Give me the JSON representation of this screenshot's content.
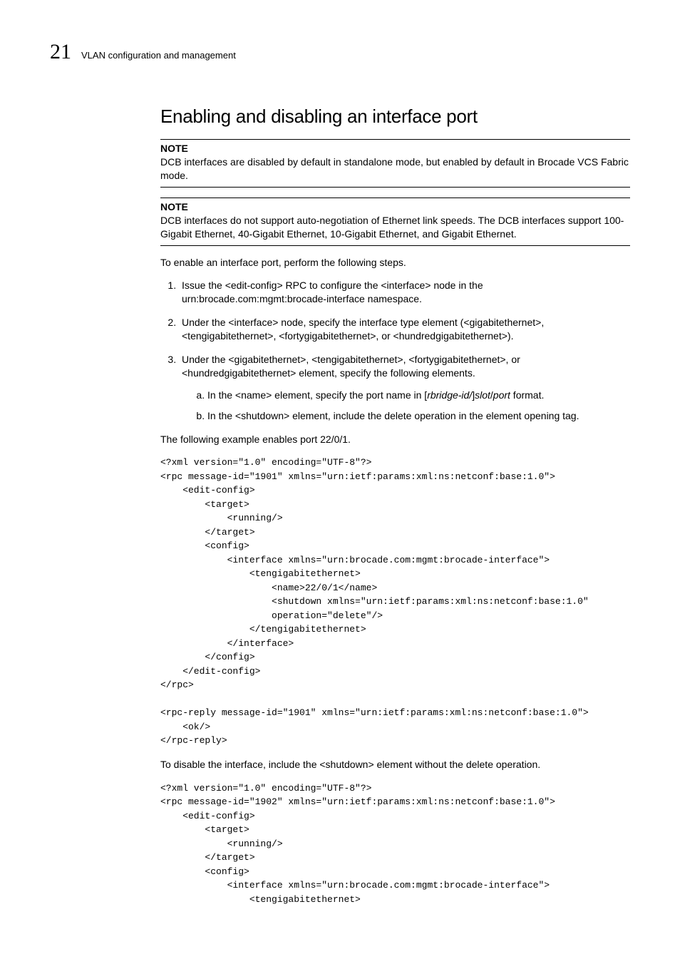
{
  "header": {
    "chapnum": "21",
    "chapter": "VLAN configuration and management"
  },
  "section_title": "Enabling and disabling an interface port",
  "note1": {
    "label": "NOTE",
    "body": "DCB interfaces are disabled by default in standalone mode, but enabled by default in Brocade VCS Fabric mode."
  },
  "note2": {
    "label": "NOTE",
    "body": "DCB interfaces do not support auto-negotiation of Ethernet link speeds. The DCB interfaces support 100-Gigabit Ethernet, 40-Gigabit Ethernet, 10-Gigabit Ethernet, and Gigabit Ethernet."
  },
  "intro": "To enable an interface port, perform the following steps.",
  "step1": "Issue the <edit-config> RPC to configure the <interface> node in the urn:brocade.com:mgmt:brocade-interface namespace.",
  "step2": "Under the <interface> node, specify the interface type element (<gigabitethernet>, <tengigabitethernet>, <fortygigabitethernet>, or <hundredgigabitethernet>).",
  "step3": "Under the <gigabitethernet>, <tengigabitethernet>, <fortygigabitethernet>, or <hundredgigabitethernet> element, specify the following elements.",
  "step3a_pre": "In the <name> element, specify the port name in [",
  "step3a_it1": "rbridge-id/",
  "step3a_mid1": "]",
  "step3a_it2": "slot",
  "step3a_mid2": "/",
  "step3a_it3": "port",
  "step3a_post": " format.",
  "step3b": "In the <shutdown> element, include the delete operation in the element opening tag.",
  "example_intro": "The following example enables port 22/0/1.",
  "code1": "<?xml version=\"1.0\" encoding=\"UTF-8\"?>\n<rpc message-id=\"1901\" xmlns=\"urn:ietf:params:xml:ns:netconf:base:1.0\">\n    <edit-config>\n        <target>\n            <running/>\n        </target>\n        <config>\n            <interface xmlns=\"urn:brocade.com:mgmt:brocade-interface\">\n                <tengigabitethernet>\n                    <name>22/0/1</name>\n                    <shutdown xmlns=\"urn:ietf:params:xml:ns:netconf:base:1.0\"\n                    operation=\"delete\"/>\n                </tengigabitethernet>\n            </interface>\n        </config>\n    </edit-config>\n</rpc>\n\n<rpc-reply message-id=\"1901\" xmlns=\"urn:ietf:params:xml:ns:netconf:base:1.0\">\n    <ok/>\n</rpc-reply>",
  "disable_intro": "To disable the interface, include the <shutdown> element without the delete operation.",
  "code2": "<?xml version=\"1.0\" encoding=\"UTF-8\"?>\n<rpc message-id=\"1902\" xmlns=\"urn:ietf:params:xml:ns:netconf:base:1.0\">\n    <edit-config>\n        <target>\n            <running/>\n        </target>\n        <config>\n            <interface xmlns=\"urn:brocade.com:mgmt:brocade-interface\">\n                <tengigabitethernet>"
}
